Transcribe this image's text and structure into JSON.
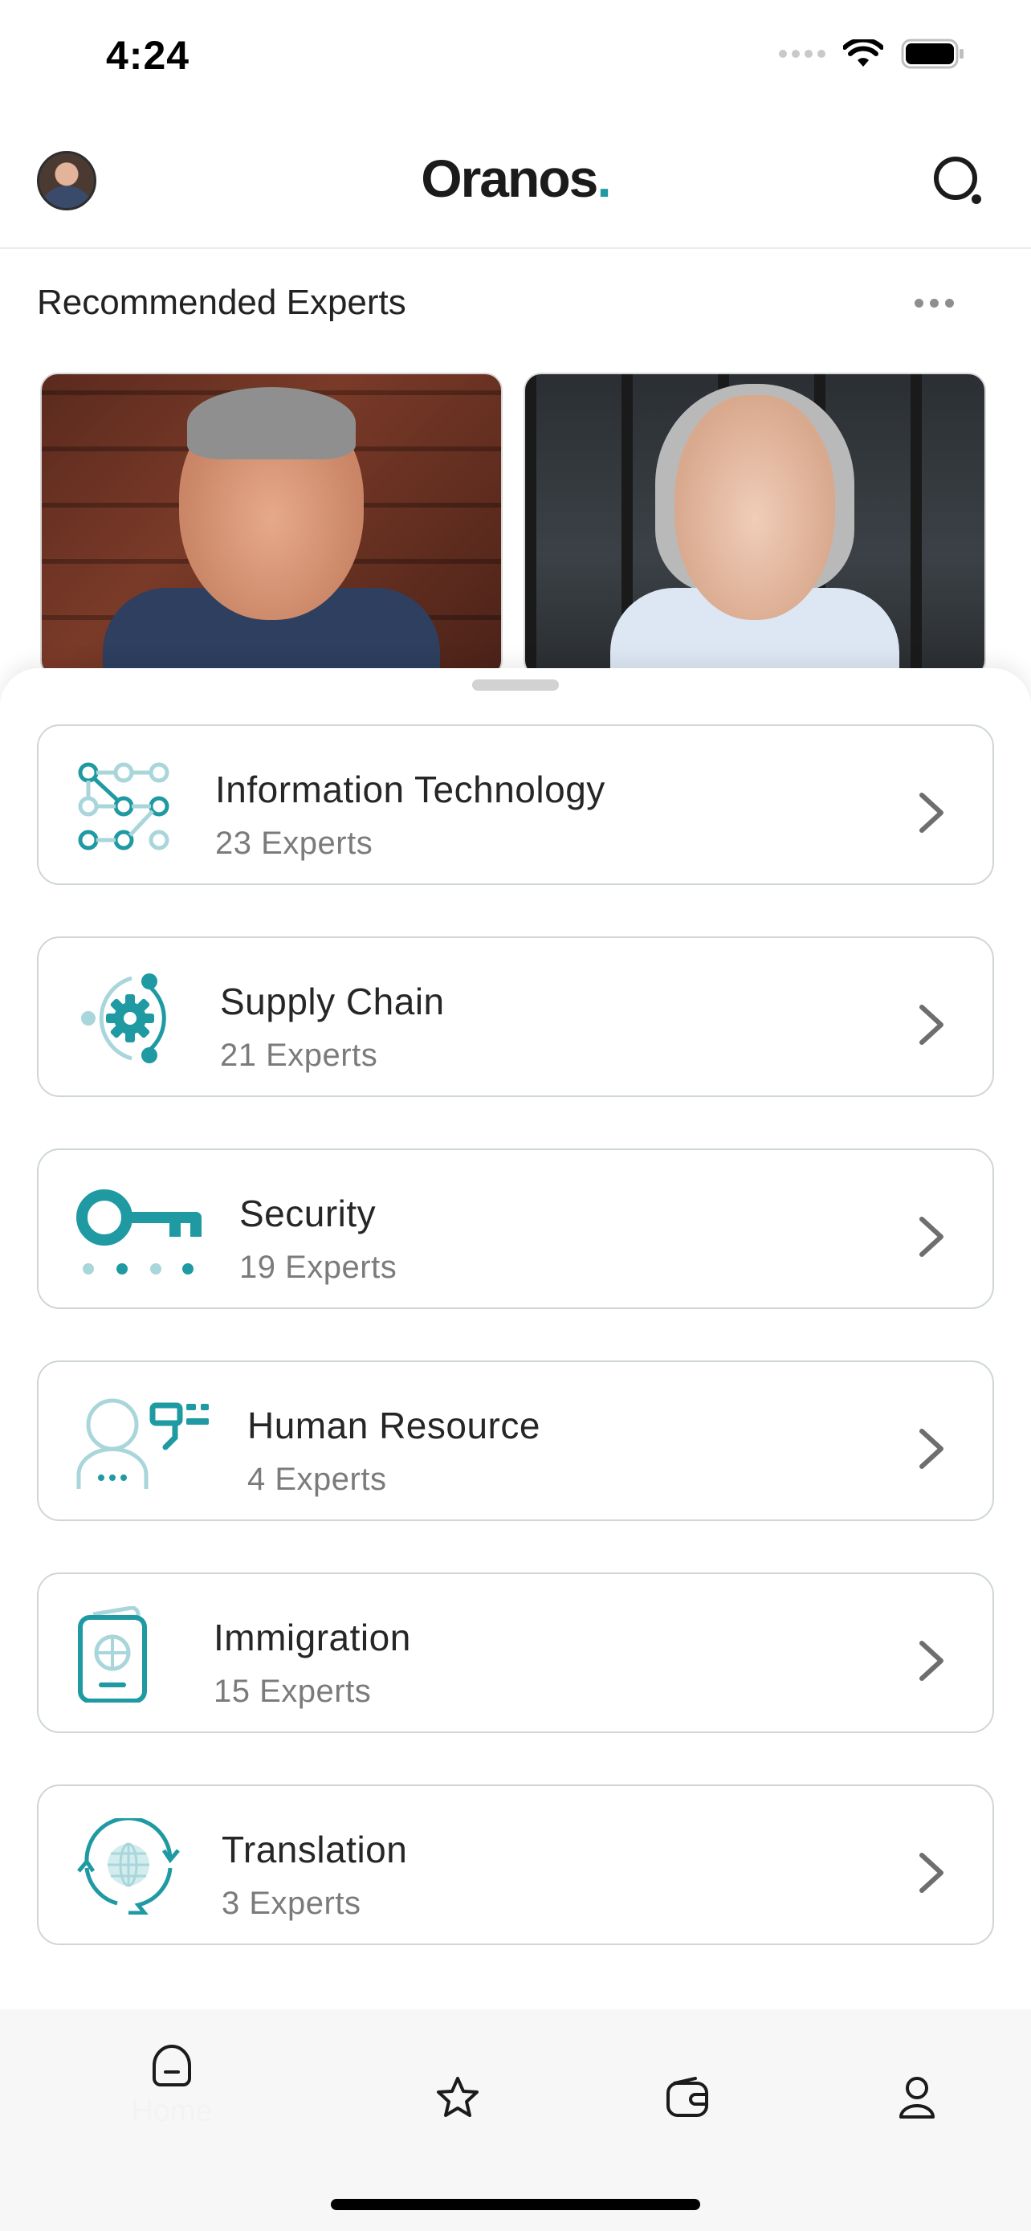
{
  "status": {
    "time": "4:24"
  },
  "header": {
    "brand": "Oranos",
    "brand_dot": "."
  },
  "recommended": {
    "title": "Recommended Experts"
  },
  "categories": [
    {
      "name": "Information Technology",
      "count": "23 Experts",
      "icon": "circuit-icon"
    },
    {
      "name": "Supply Chain",
      "count": "21 Experts",
      "icon": "gear-cycle-icon"
    },
    {
      "name": "Security",
      "count": "19 Experts",
      "icon": "key-icon"
    },
    {
      "name": "Human Resource",
      "count": "4 Experts",
      "icon": "person-chat-icon"
    },
    {
      "name": "Immigration",
      "count": "15 Experts",
      "icon": "passport-icon"
    },
    {
      "name": "Translation",
      "count": "3 Experts",
      "icon": "globe-chat-icon"
    }
  ],
  "tabs": [
    {
      "label": "Home",
      "icon": "home-icon"
    },
    {
      "label": "",
      "icon": "star-icon"
    },
    {
      "label": "",
      "icon": "wallet-icon"
    },
    {
      "label": "",
      "icon": "profile-icon"
    }
  ],
  "colors": {
    "accent": "#1f9aa2",
    "accent_light": "#a9d6da"
  }
}
